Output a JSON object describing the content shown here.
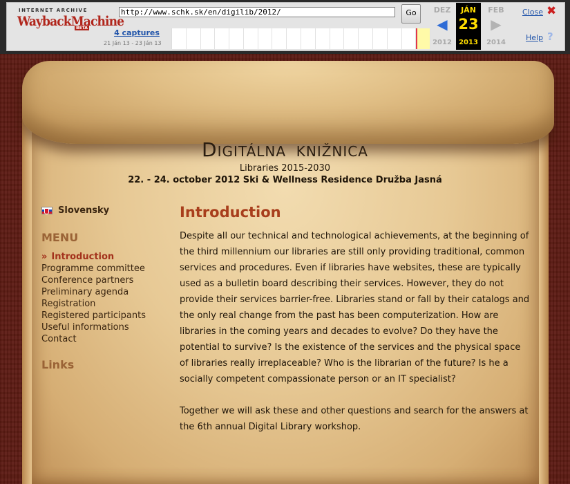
{
  "wayback": {
    "logo": {
      "line1": "INTERNET ARCHIVE",
      "line2": "WaybackMachine",
      "badge": "BETA"
    },
    "url": "http://www.schk.sk/en/digilib/2012/",
    "go_label": "Go",
    "captures_label": "4 captures",
    "range_label": "21 Ján 13 - 23 Ján 13",
    "prev": {
      "month": "DEZ",
      "year": "2012"
    },
    "current": {
      "month": "JÁN",
      "day": "23",
      "year": "2013"
    },
    "next": {
      "month": "FEB",
      "year": "2014"
    },
    "close_label": "Close",
    "help_label": "Help",
    "accent": "#2f6cd6",
    "highlight": "#ffdd00"
  },
  "site": {
    "title_initial": "D",
    "title_rest": "IGITÁLNA  KNIŽNICA",
    "subtitle": "Libraries 2015-2030",
    "event": "22. - 24. october 2012 Ski & Wellness Residence Družba Jasná"
  },
  "sidebar": {
    "language": "Slovensky",
    "menu_heading": "MENU",
    "items": [
      {
        "label": "Introduction",
        "active": true
      },
      {
        "label": "Programme committee"
      },
      {
        "label": "Conference partners"
      },
      {
        "label": "Preliminary agenda"
      },
      {
        "label": "Registration"
      },
      {
        "label": "Registered participants"
      },
      {
        "label": "Useful informations"
      },
      {
        "label": "Contact"
      }
    ],
    "links_heading": "Links",
    "active_marker": "»"
  },
  "main": {
    "title": "Introduction",
    "paragraphs": [
      "Despite all our technical and technological achievements, at the beginning of the third millennium our libraries are still only providing traditional, common services and procedures. Even if libraries have websites, these are typically used as a bulletin board describing their services. However, they do not provide their services barrier-free. Libraries stand or fall by their catalogs and the only real change from the past has been computerization. How are libraries in the coming years and decades to evolve? Do they have the potential to survive? Is the existence of the services and the physical space of libraries really irreplaceable? Who is the librarian of the future? Is he a socially competent compassionate person or an IT specialist?",
      "Together we will ask these and other questions and search for the answers at the 6th annual Digital Library workshop."
    ]
  }
}
